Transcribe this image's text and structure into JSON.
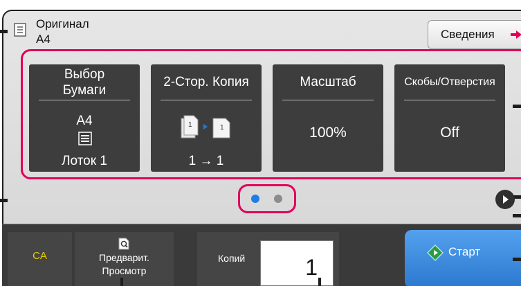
{
  "original": {
    "title": "Оригинал",
    "size": "A4",
    "icon": "document-icon"
  },
  "info_button": {
    "label": "Сведения",
    "icon": "arrow-right-icon"
  },
  "tiles": [
    {
      "title_line1": "Выбор",
      "title_line2": "Бумаги",
      "size": "A4",
      "icon": "paper-tray-icon",
      "value": "Лоток 1"
    },
    {
      "title": "2-Стор. Копия",
      "icon": "duplex-copy-icon",
      "value": "1 → 1"
    },
    {
      "title": "Масштаб",
      "value": "100%"
    },
    {
      "title": "Скобы/Отверстия",
      "value": "Off"
    }
  ],
  "page_dots": {
    "total": 2,
    "active": 1,
    "active_color": "#1f7ee0",
    "inactive_color": "#8c8c8c"
  },
  "bottom": {
    "ca_label": "CA",
    "preview_label_line1": "Предварит.",
    "preview_label_line2": "Просмотр",
    "preview_icon": "magnify-page-icon",
    "copies_label": "Копий",
    "copies_value": "1",
    "start_label": "Старт",
    "start_icon": "start-diamond-icon"
  },
  "colors": {
    "highlight": "#e0005a",
    "tile_bg": "#3d3d3d",
    "start_bg": "#2c78cf",
    "ca_text": "#e6cc00"
  }
}
